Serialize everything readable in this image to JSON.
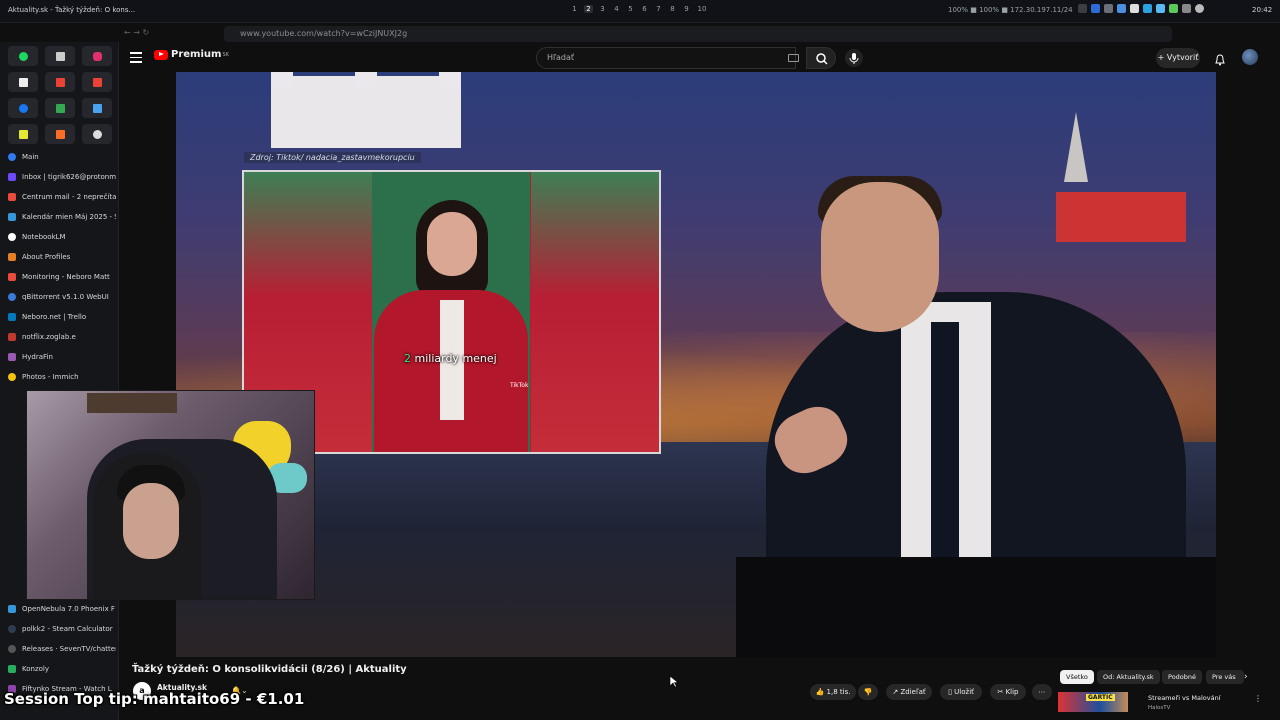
{
  "os_bar": {
    "window_title": "Aktuality.sk - Ťažký týždeň: O kons...",
    "workspaces": [
      "1",
      "2",
      "3",
      "4",
      "5",
      "6",
      "7",
      "8",
      "9",
      "10"
    ],
    "active_workspace": "2",
    "stats": "100% ■ 100% ■  172.30.197.11/24",
    "clock": "20:42"
  },
  "browser": {
    "url": "www.youtube.com/watch?v=wCziJNUXJ2g"
  },
  "sidebar": {
    "tabs": [
      {
        "label": "Main",
        "color": "#2f7bf0"
      },
      {
        "label": "Inbox | tigrik626@protonm",
        "color": "#6d4aff"
      },
      {
        "label": "Centrum mail - 2 neprečíta",
        "color": "#e74c3c"
      },
      {
        "label": "Kalendár mien Máj 2025 - S",
        "color": "#3498db"
      },
      {
        "label": "NotebookLM",
        "color": "#ffffff"
      },
      {
        "label": "About Profiles",
        "color": "#e67e22"
      },
      {
        "label": "Monitoring - Neboro Matt",
        "color": "#e74c3c"
      },
      {
        "label": "qBittorrent v5.1.0 WebUI",
        "color": "#3a7bd5"
      },
      {
        "label": "Neboro.net | Trello",
        "color": "#0079bf"
      },
      {
        "label": "notflix.zoglab.e",
        "color": "#c0392b"
      },
      {
        "label": "HydraFin",
        "color": "#9b59b6"
      },
      {
        "label": "Photos - Immich",
        "color": "#f1c40f"
      },
      {
        "label": "OpenNebula 7.0 Phoenix F",
        "color": "#3498db"
      },
      {
        "label": "polkk2 - Steam Calculator",
        "color": "#2c3e50"
      },
      {
        "label": "Releases · SevenTV/chatter",
        "color": "#555555"
      },
      {
        "label": "Konzoly",
        "color": "#27ae60"
      },
      {
        "label": "Fiftynko Stream - Watch L",
        "color": "#8e44ad"
      }
    ]
  },
  "youtube": {
    "logo_text": "Premium",
    "logo_sup": "SK",
    "search_placeholder": "Hľadať",
    "create_label": "Vytvoriť",
    "video": {
      "source_caption": "Zdroj: Tiktok/ nadacia_zastavmekorupciu",
      "subtitle_highlight": "2",
      "subtitle_rest": " miliardy menej",
      "tiktok_label": "TikTok",
      "title": "Ťažký týždeň: O konsolikvidácii (8/26) | Aktuality"
    },
    "channel": {
      "avatar_text": "a",
      "name": "Aktuality.sk"
    },
    "actions": {
      "like": "1,8 tis.",
      "share": "Zdieľať",
      "save": "Uložiť",
      "clip": "Klip",
      "more": "⋯"
    },
    "chips": [
      "Všetko",
      "Od: Aktuality.sk",
      "Podobné",
      "Pre vás"
    ],
    "recommended": {
      "thumb_text": "GARTIC",
      "title": "Streameři vs Malování",
      "channel": "HalosTV"
    }
  },
  "overlay": {
    "tip_text": "Session Top tip: mahtaito69 - €1.01"
  }
}
